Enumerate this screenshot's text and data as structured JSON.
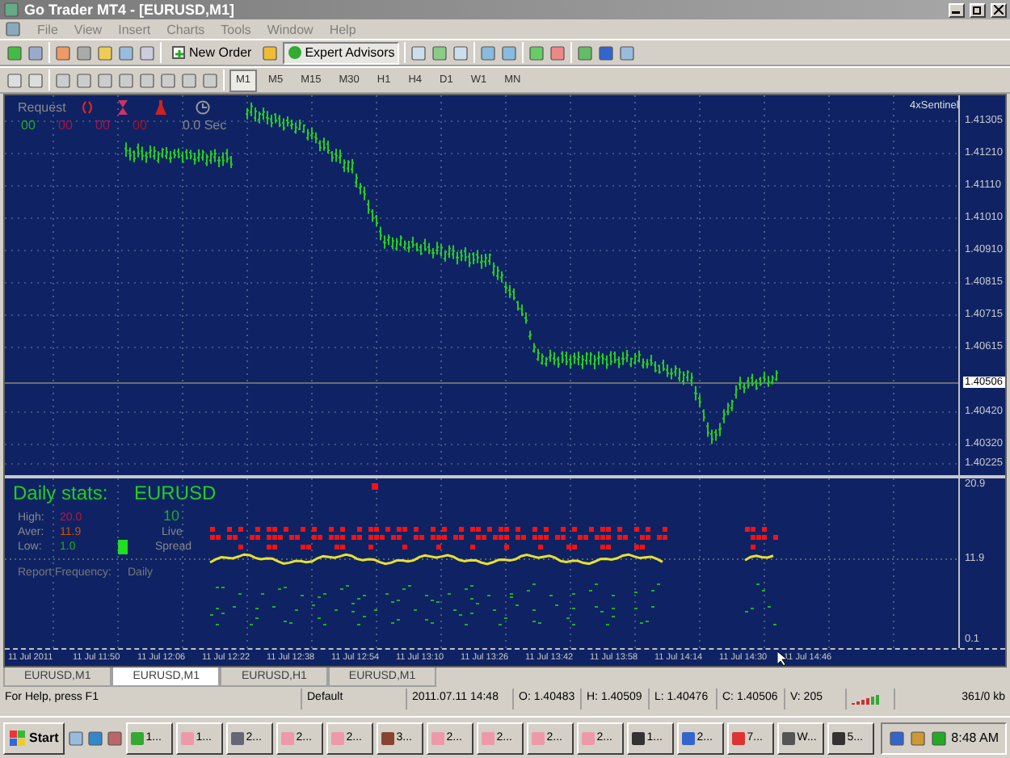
{
  "window": {
    "title": "Go Trader MT4 - [EURUSD,M1]"
  },
  "menu": [
    "File",
    "View",
    "Insert",
    "Charts",
    "Tools",
    "Window",
    "Help"
  ],
  "toolbar": {
    "new_order": "New Order",
    "expert_advisors": "Expert Advisors"
  },
  "timeframes": [
    {
      "label": "M1",
      "selected": true
    },
    {
      "label": "M5",
      "selected": false
    },
    {
      "label": "M15",
      "selected": false
    },
    {
      "label": "M30",
      "selected": false
    },
    {
      "label": "H1",
      "selected": false
    },
    {
      "label": "H4",
      "selected": false
    },
    {
      "label": "D1",
      "selected": false
    },
    {
      "label": "W1",
      "selected": false
    },
    {
      "label": "MN",
      "selected": false
    }
  ],
  "chart": {
    "request_label": "Request",
    "counters": [
      {
        "value": "00",
        "color": "#22aa22"
      },
      {
        "value": "00",
        "color": "#aa1144"
      },
      {
        "value": "00",
        "color": "#aa1144"
      },
      {
        "value": "00",
        "color": "#aa1122"
      }
    ],
    "latency": "0.0 Sec",
    "indicator_name": "4xSentinel",
    "price_axis": [
      "1.41305",
      "1.41210",
      "1.41110",
      "1.41010",
      "1.40910",
      "1.40815",
      "1.40715",
      "1.40615",
      "1.40420",
      "1.40320",
      "1.40225"
    ],
    "current_price": "1.40506"
  },
  "daily_stats": {
    "title": "Daily stats:",
    "symbol": "EURUSD",
    "rows": [
      {
        "label": "High:",
        "value": "20.0",
        "color": "#cc1133"
      },
      {
        "label": "Aver:",
        "value": "11.9",
        "color": "#cc5500"
      },
      {
        "label": "Low:",
        "value": "1.0",
        "color": "#22aa22"
      }
    ],
    "live_value": "10",
    "live_label": "Live",
    "spread_label": "Spread",
    "report_label": "Report Frequency:",
    "report_value": "Daily",
    "axis": [
      "20.9",
      "11.9",
      "0.1"
    ]
  },
  "time_axis": [
    "11 Jul 2011",
    "11 Jul 11:50",
    "11 Jul 12:06",
    "11 Jul 12:22",
    "11 Jul 12:38",
    "11 Jul 12:54",
    "11 Jul 13:10",
    "11 Jul 13:26",
    "11 Jul 13:42",
    "11 Jul 13:58",
    "11 Jul 14:14",
    "11 Jul 14:30",
    "11 Jul 14:46"
  ],
  "chart_tabs": [
    {
      "label": "EURUSD,M1",
      "selected": false
    },
    {
      "label": "EURUSD,M1",
      "selected": true
    },
    {
      "label": "EURUSD,H1",
      "selected": false
    },
    {
      "label": "EURUSD,M1",
      "selected": false
    }
  ],
  "status_bar": {
    "help": "For Help, press F1",
    "profile": "Default",
    "time": "2011.07.11 14:48",
    "open": "O: 1.40483",
    "high": "H: 1.40509",
    "low": "L: 1.40476",
    "close": "C: 1.40506",
    "volume": "V: 205",
    "traffic": "361/0 kb"
  },
  "taskbar": {
    "start": "Start",
    "tasks": [
      "1...",
      "1...",
      "2...",
      "2...",
      "2...",
      "3...",
      "2...",
      "2...",
      "2...",
      "2...",
      "1...",
      "2...",
      "7...",
      "W...",
      "5..."
    ],
    "clock": "8:48 AM"
  }
}
